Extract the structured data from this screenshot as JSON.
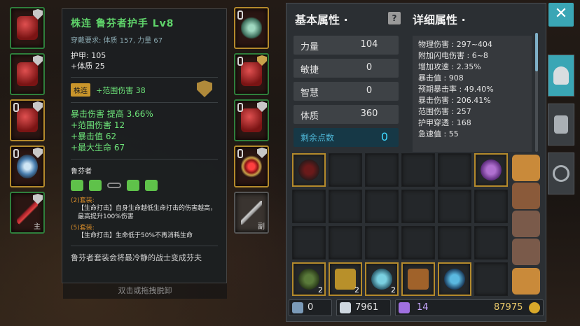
{
  "item": {
    "name": "株连  鲁芬者护手  Lv8",
    "requirement": "穿戴要求:  体质 157, 力量 67",
    "base_stats": [
      "护甲:  105",
      "+体质 25"
    ],
    "tag_label": "株连",
    "tag_effect": "+范围伤害 38",
    "affixes": [
      "暴击伤害  提高  3.66%",
      "+范围伤害 12",
      "+暴击值 62",
      "+最大生命 67"
    ],
    "set": {
      "name": "鲁芬者",
      "bonus2_req": "(2)套装:",
      "bonus2_desc": "【生命打击】自身生命越低生命打击的伤害越高，最高提升100%伤害",
      "bonus5_req": "(5)套装:",
      "bonus5_desc": "【生命打击】生命低于50%不再消耗生命"
    },
    "flavor": "鲁芬者套装会将最冷静的战士变成芬夫"
  },
  "hint": "双击或拖拽脱卸",
  "left_slot_tags": {
    "slot5": "主",
    "slot_weapon2": "副"
  },
  "basic": {
    "title": "基本属性 ·",
    "help_icon": "?",
    "rows": [
      {
        "label": "力量",
        "value": "104"
      },
      {
        "label": "敏捷",
        "value": "0"
      },
      {
        "label": "智慧",
        "value": "0"
      },
      {
        "label": "体质",
        "value": "360"
      }
    ],
    "remain_label": "剩余点数",
    "remain_value": "0"
  },
  "detail": {
    "title": "详细属性 ·",
    "lines": [
      "物理伤害 : 297~404",
      "附加闪电伤害 : 6~8",
      "增加攻速 : 2.35%",
      "暴击值 : 908",
      "预期暴击率 : 49.40%",
      "暴击伤害 : 206.41%",
      "范围伤害 : 257",
      "护甲穿透 : 168",
      "急速值 : 55"
    ]
  },
  "inventory_counts": [
    "2",
    "2",
    "2"
  ],
  "currency": {
    "gear": "0",
    "crystal": "7961",
    "gem": "14",
    "gold": "87975"
  },
  "buttons": {
    "close": "✕"
  },
  "colors": {
    "accent": "#3aa6b5",
    "set_green": "#6ee57a",
    "gold_border": "#b48a2c"
  }
}
